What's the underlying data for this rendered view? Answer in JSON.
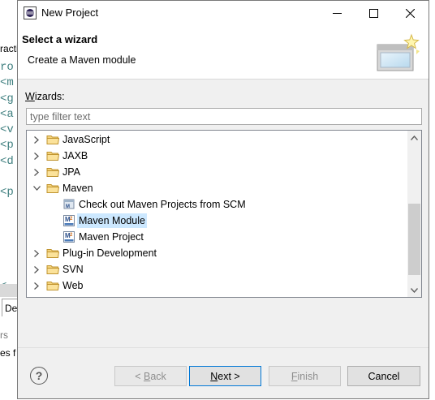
{
  "background": {
    "code_fragments": [
      "ro",
      "<m",
      "<g",
      "<a",
      "<v",
      "<p",
      "<d",
      "",
      "<p",
      "",
      "",
      "",
      "",
      "",
      "<"
    ],
    "top_fragment": "racti",
    "tab_fragment": "De",
    "bottom_fragment_1": "rs",
    "bottom_fragment_2": "es f"
  },
  "dialog": {
    "title": "New Project",
    "header": {
      "title": "Select a wizard",
      "description": "Create a Maven module"
    },
    "wizards_label_prefix": "W",
    "wizards_label_rest": "izards:",
    "filter": {
      "value": "",
      "placeholder": "type filter text"
    },
    "tree": [
      {
        "label": "JavaScript",
        "level": 0,
        "icon": "folder-icon",
        "expanded": false
      },
      {
        "label": "JAXB",
        "level": 0,
        "icon": "folder-icon",
        "expanded": false
      },
      {
        "label": "JPA",
        "level": 0,
        "icon": "folder-icon",
        "expanded": false
      },
      {
        "label": "Maven",
        "level": 0,
        "icon": "folder-icon",
        "expanded": true
      },
      {
        "label": "Check out Maven Projects from SCM",
        "level": 1,
        "icon": "maven-checkout-icon"
      },
      {
        "label": "Maven Module",
        "level": 1,
        "icon": "maven-module-icon",
        "selected": true
      },
      {
        "label": "Maven Project",
        "level": 1,
        "icon": "maven-project-icon"
      },
      {
        "label": "Plug-in Development",
        "level": 0,
        "icon": "folder-icon",
        "expanded": false
      },
      {
        "label": "SVN",
        "level": 0,
        "icon": "folder-icon",
        "expanded": false
      },
      {
        "label": "Web",
        "level": 0,
        "icon": "folder-icon",
        "expanded": false
      }
    ],
    "buttons": {
      "back_prefix": "< ",
      "back_mnemonic": "B",
      "back_rest": "ack",
      "next_mnemonic": "N",
      "next_rest": "ext >",
      "finish_mnemonic": "F",
      "finish_rest": "inish",
      "cancel": "Cancel"
    },
    "colors": {
      "selection": "#cce8ff",
      "default_button_border": "#0078d7"
    }
  }
}
